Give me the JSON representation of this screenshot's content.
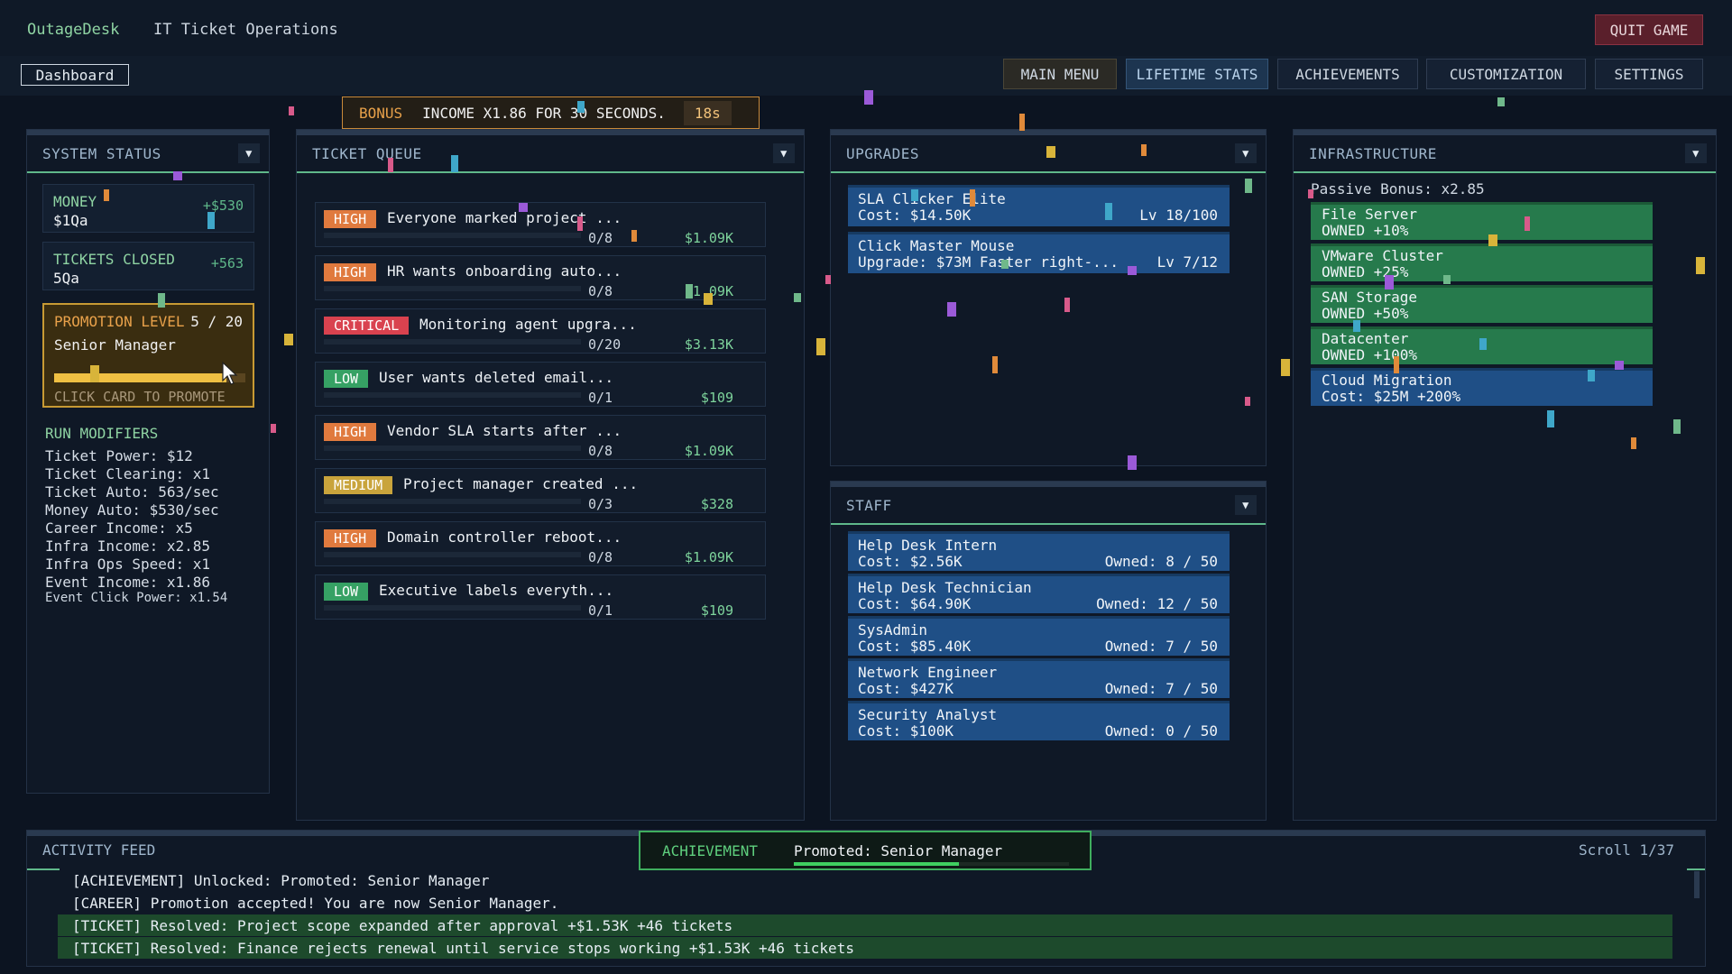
{
  "header": {
    "app_name": "OutageDesk",
    "subtitle": "IT Ticket Operations",
    "quit_label": "QUIT GAME"
  },
  "nav": {
    "dashboard_tab": "Dashboard",
    "buttons": [
      "MAIN MENU",
      "LIFETIME STATS",
      "ACHIEVEMENTS",
      "CUSTOMIZATION",
      "SETTINGS"
    ]
  },
  "bonus": {
    "tag": "BONUS",
    "message": "INCOME X1.86 FOR 30 SECONDS.",
    "timer": "18s"
  },
  "system_status": {
    "title": "SYSTEM STATUS",
    "money": {
      "label": "MONEY",
      "value": "$1Qa",
      "delta": "+$530"
    },
    "tickets_closed": {
      "label": "TICKETS CLOSED",
      "value": "5Qa",
      "delta": "+563"
    },
    "promotion": {
      "label": "PROMOTION LEVEL",
      "level": "5 / 20",
      "role": "Senior Manager",
      "progress": 0.9,
      "hint": "CLICK CARD TO PROMOTE"
    },
    "modifiers_title": "RUN MODIFIERS",
    "modifiers": [
      "Ticket Power: $12",
      "Ticket Clearing: x1",
      "Ticket Auto: 563/sec",
      "Money Auto: $530/sec",
      "Career Income: x5",
      "Infra Income: x2.85",
      "Infra Ops Speed: x1",
      "Event Income: x1.86"
    ],
    "event_click_power": "Event Click Power: x1.54"
  },
  "ticket_queue": {
    "title": "TICKET QUEUE",
    "tickets": [
      {
        "priority": "HIGH",
        "color": "#e07a3e",
        "title": "Everyone marked project ...",
        "progress": "0/8",
        "reward": "$1.09K"
      },
      {
        "priority": "HIGH",
        "color": "#e07a3e",
        "title": "HR wants onboarding auto...",
        "progress": "0/8",
        "reward": "$1.09K"
      },
      {
        "priority": "CRITICAL",
        "color": "#d9424f",
        "title": "Monitoring agent upgra...",
        "progress": "0/20",
        "reward": "$3.13K"
      },
      {
        "priority": "LOW",
        "color": "#36a164",
        "title": "User wants deleted email...",
        "progress": "0/1",
        "reward": "$109"
      },
      {
        "priority": "HIGH",
        "color": "#e07a3e",
        "title": "Vendor SLA starts after ...",
        "progress": "0/8",
        "reward": "$1.09K"
      },
      {
        "priority": "MEDIUM",
        "color": "#c9a43c",
        "title": "Project manager created ...",
        "progress": "0/3",
        "reward": "$328"
      },
      {
        "priority": "HIGH",
        "color": "#e07a3e",
        "title": "Domain controller reboot...",
        "progress": "0/8",
        "reward": "$1.09K"
      },
      {
        "priority": "LOW",
        "color": "#36a164",
        "title": "Executive labels everyth...",
        "progress": "0/1",
        "reward": "$109"
      }
    ]
  },
  "upgrades": {
    "title": "UPGRADES",
    "items": [
      {
        "name": "SLA Clicker Elite",
        "cost": "Cost: $14.50K",
        "level": "Lv 18/100"
      },
      {
        "name": "Click Master Mouse",
        "cost": "Upgrade: $73M  Faster right-...",
        "level": "Lv 7/12"
      }
    ]
  },
  "staff": {
    "title": "STAFF",
    "items": [
      {
        "name": "Help Desk Intern",
        "cost": "Cost: $2.56K",
        "owned": "Owned: 8 / 50"
      },
      {
        "name": "Help Desk Technician",
        "cost": "Cost: $64.90K",
        "owned": "Owned: 12 / 50"
      },
      {
        "name": "SysAdmin",
        "cost": "Cost: $85.40K",
        "owned": "Owned: 7 / 50"
      },
      {
        "name": "Network Engineer",
        "cost": "Cost: $427K",
        "owned": "Owned: 7 / 50"
      },
      {
        "name": "Security Analyst",
        "cost": "Cost: $100K",
        "owned": "Owned: 0 / 50"
      }
    ]
  },
  "infrastructure": {
    "title": "INFRASTRUCTURE",
    "passive_bonus": "Passive Bonus: x2.85",
    "items": [
      {
        "name": "File Server",
        "status": "OWNED  +10%",
        "owned": true
      },
      {
        "name": "VMware Cluster",
        "status": "OWNED  +25%",
        "owned": true
      },
      {
        "name": "SAN Storage",
        "status": "OWNED  +50%",
        "owned": true
      },
      {
        "name": "Datacenter",
        "status": "OWNED  +100%",
        "owned": true
      },
      {
        "name": "Cloud Migration",
        "status": "Cost: $25M  +200%",
        "owned": false
      }
    ]
  },
  "activity_feed": {
    "title": "ACTIVITY FEED",
    "scroll": "Scroll 1/37",
    "lines": [
      "[ACHIEVEMENT] Unlocked: Promoted: Senior Manager",
      "[CAREER] Promotion accepted! You are now Senior Manager.",
      "[TICKET] Resolved: Project scope expanded after approval  +$1.53K  +46 tickets",
      "[TICKET] Resolved: Finance rejects renewal until service stops working  +$1.53K  +46 tickets"
    ]
  },
  "toast": {
    "tag": "ACHIEVEMENT",
    "message": "Promoted: Senior Manager",
    "progress": 0.6
  }
}
